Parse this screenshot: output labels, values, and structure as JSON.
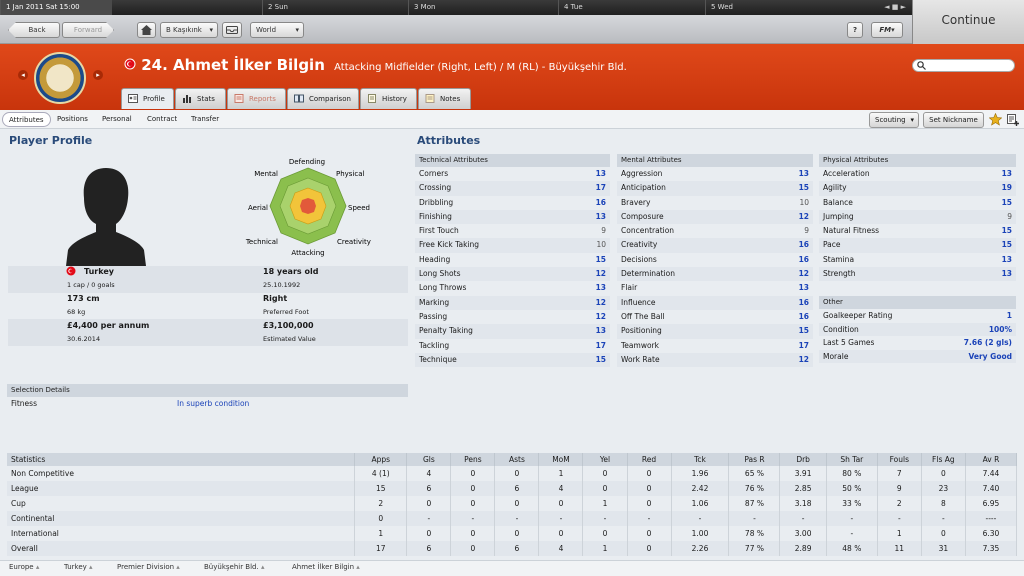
{
  "datebar": {
    "current": "1 Jan 2011  Sat 15:00",
    "days": [
      "2 Sun",
      "3 Mon",
      "4 Tue",
      "5 Wed"
    ],
    "controls": "◄ ■ ►"
  },
  "toolbar": {
    "back": "Back",
    "forward": "Forward",
    "club_select": "B Kaşıkınk",
    "world_select": "World",
    "help": "?",
    "fm_menu": "FM"
  },
  "continue_label": "Continue",
  "player": {
    "name": "24. Ahmet İlker Bilgin",
    "role": "Attacking Midfielder (Right, Left) / M (RL) - Büyükşehir Bld."
  },
  "tabs": [
    "Profile",
    "Stats",
    "Reports",
    "Comparison",
    "History",
    "Notes"
  ],
  "subtabs": [
    "Attributes",
    "Positions",
    "Personal",
    "Contract",
    "Transfer"
  ],
  "right_buttons": {
    "scouting": "Scouting",
    "nickname": "Set Nickname"
  },
  "profile": {
    "title": "Player Profile",
    "radar_labels": [
      "Defending",
      "Physical",
      "Speed",
      "Creativity",
      "Attacking",
      "Technical",
      "Aerial",
      "Mental"
    ],
    "nation": "Turkey",
    "caps": "1 cap / 0 goals",
    "height": "173 cm",
    "weight": "68 kg",
    "wage": "£4,400 per annum",
    "contract": "30.6.2014",
    "age": "18 years old",
    "dob": "25.10.1992",
    "foot": "Right",
    "foot_label": "Preferred Foot",
    "value": "£3,100,000",
    "value_label": "Estimated Value"
  },
  "attributes": {
    "title": "Attributes",
    "technical": {
      "header": "Technical Attributes",
      "rows": [
        [
          "Corners",
          "13"
        ],
        [
          "Crossing",
          "17"
        ],
        [
          "Dribbling",
          "16"
        ],
        [
          "Finishing",
          "13"
        ],
        [
          "First Touch",
          "9"
        ],
        [
          "Free Kick Taking",
          "10"
        ],
        [
          "Heading",
          "15"
        ],
        [
          "Long Shots",
          "12"
        ],
        [
          "Long Throws",
          "13"
        ],
        [
          "Marking",
          "12"
        ],
        [
          "Passing",
          "12"
        ],
        [
          "Penalty Taking",
          "13"
        ],
        [
          "Tackling",
          "17"
        ],
        [
          "Technique",
          "15"
        ]
      ]
    },
    "mental": {
      "header": "Mental Attributes",
      "rows": [
        [
          "Aggression",
          "13"
        ],
        [
          "Anticipation",
          "15"
        ],
        [
          "Bravery",
          "10"
        ],
        [
          "Composure",
          "12"
        ],
        [
          "Concentration",
          "9"
        ],
        [
          "Creativity",
          "16"
        ],
        [
          "Decisions",
          "16"
        ],
        [
          "Determination",
          "12"
        ],
        [
          "Flair",
          "13"
        ],
        [
          "Influence",
          "16"
        ],
        [
          "Off The Ball",
          "16"
        ],
        [
          "Positioning",
          "15"
        ],
        [
          "Teamwork",
          "17"
        ],
        [
          "Work Rate",
          "12"
        ]
      ]
    },
    "physical": {
      "header": "Physical Attributes",
      "rows": [
        [
          "Acceleration",
          "13"
        ],
        [
          "Agility",
          "19"
        ],
        [
          "Balance",
          "15"
        ],
        [
          "Jumping",
          "9"
        ],
        [
          "Natural Fitness",
          "15"
        ],
        [
          "Pace",
          "15"
        ],
        [
          "Stamina",
          "13"
        ],
        [
          "Strength",
          "13"
        ]
      ]
    },
    "other": {
      "header": "Other",
      "rows": [
        [
          "Goalkeeper Rating",
          "1"
        ],
        [
          "Condition",
          "100%"
        ],
        [
          "Last 5 Games",
          "7.66 (2 gls)"
        ],
        [
          "Morale",
          "Very Good"
        ]
      ]
    }
  },
  "selection": {
    "header": "Selection Details",
    "fitness_label": "Fitness",
    "fitness_value": "In superb condition"
  },
  "statistics": {
    "columns": [
      "Statistics",
      "Apps",
      "Gls",
      "Pens",
      "Asts",
      "MoM",
      "Yel",
      "Red",
      "Tck",
      "Pas R",
      "Drb",
      "Sh Tar",
      "Fouls",
      "Fls Ag",
      "Av R"
    ],
    "rows": [
      [
        "Non Competitive",
        "4 (1)",
        "4",
        "0",
        "0",
        "1",
        "0",
        "0",
        "1.96",
        "65 %",
        "3.91",
        "80 %",
        "7",
        "0",
        "7.44"
      ],
      [
        "League",
        "15",
        "6",
        "0",
        "6",
        "4",
        "0",
        "0",
        "2.42",
        "76 %",
        "2.85",
        "50 %",
        "9",
        "23",
        "7.40"
      ],
      [
        "Cup",
        "2",
        "0",
        "0",
        "0",
        "0",
        "1",
        "0",
        "1.06",
        "87 %",
        "3.18",
        "33 %",
        "2",
        "8",
        "6.95"
      ],
      [
        "Continental",
        "0",
        "-",
        "-",
        "-",
        "-",
        "-",
        "-",
        "-",
        "-",
        "-",
        "-",
        "-",
        "-",
        "----"
      ],
      [
        "International",
        "1",
        "0",
        "0",
        "0",
        "0",
        "0",
        "0",
        "1.00",
        "78 %",
        "3.00",
        "-",
        "1",
        "0",
        "6.30"
      ],
      [
        "Overall",
        "17",
        "6",
        "0",
        "6",
        "4",
        "1",
        "0",
        "2.26",
        "77 %",
        "2.89",
        "48 %",
        "11",
        "31",
        "7.35"
      ]
    ]
  },
  "breadcrumbs": [
    "Europe",
    "Turkey",
    "Premier Division",
    "Büyükşehir Bld.",
    "Ahmet İlker Bilgin"
  ],
  "colors": {
    "banner": "#d9421a",
    "value_blue": "#1b43b8",
    "title_blue": "#2a4b7a"
  }
}
